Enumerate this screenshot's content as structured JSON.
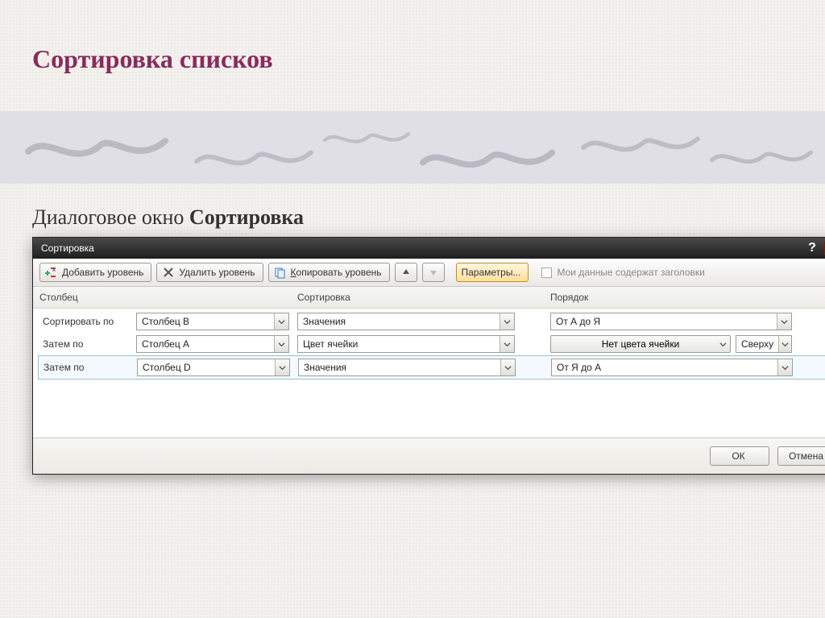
{
  "slide": {
    "title": "Сортировка списков",
    "subtitle_prefix": "Диалоговое окно ",
    "subtitle_bold": "Сортировка"
  },
  "dialog": {
    "title": "Сортировка",
    "toolbar": {
      "add_level": "Добавить уровень",
      "delete_level": "Удалить уровень",
      "copy_level": "Копировать уровень",
      "parameters": "Параметры...",
      "headers_checkbox": "Мои данные содержат заголовки"
    },
    "headers": {
      "column": "Столбец",
      "sort_on": "Сортировка",
      "order": "Порядок"
    },
    "rows": [
      {
        "label": "Сортировать по",
        "column": "Столбец B",
        "sort_on": "Значения",
        "order_type": "text",
        "order": "От А до Я"
      },
      {
        "label": "Затем по",
        "column": "Столбец A",
        "sort_on": "Цвет ячейки",
        "order_type": "color",
        "color_label": "Нет цвета ячейки",
        "pos": "Сверху"
      },
      {
        "label": "Затем по",
        "column": "Столбец D",
        "sort_on": "Значения",
        "order_type": "text",
        "order": "От Я до А"
      }
    ],
    "footer": {
      "ok": "ОК",
      "cancel": "Отмена"
    }
  }
}
